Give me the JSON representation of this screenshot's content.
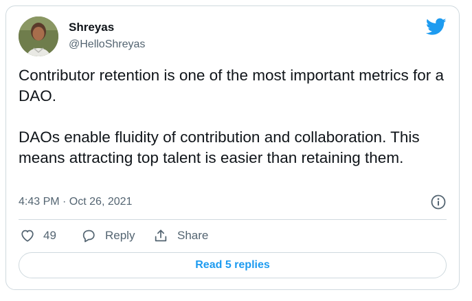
{
  "user": {
    "name": "Shreyas",
    "handle": "@HelloShreyas"
  },
  "tweet": {
    "paragraphs": [
      "Contributor retention is one of the most important metrics for a DAO.",
      "DAOs enable fluidity of contribution and collaboration. This means attracting top talent is easier than retaining them."
    ],
    "timestamp": "4:43 PM · Oct 26, 2021"
  },
  "actions": {
    "like_count": "49",
    "reply_label": "Reply",
    "share_label": "Share"
  },
  "read_replies_label": "Read 5 replies",
  "colors": {
    "brand": "#1d9bf0",
    "text": "#0f1419",
    "muted": "#536471",
    "border": "#cfd9de"
  },
  "icons": [
    "twitter-bird-icon",
    "info-icon",
    "heart-icon",
    "reply-bubble-icon",
    "share-icon"
  ]
}
